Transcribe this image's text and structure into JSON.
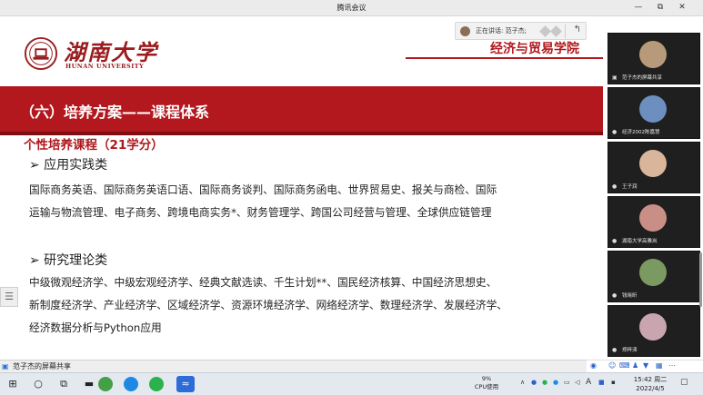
{
  "window": {
    "title": "腾讯会议",
    "controls": [
      "—",
      "⧉",
      "—",
      "☐",
      "✕"
    ]
  },
  "speaker": {
    "label": "正在讲话: 范子杰;"
  },
  "slide": {
    "logo_cn": "湖南大学",
    "logo_en": "HUNAN UNIVERSITY",
    "college": "经济与贸易学院",
    "heading": "（六）培养方案——课程体系",
    "subheading": "个性培养课程（21学分）",
    "sections": [
      {
        "title": "➢ 应用实践类",
        "lines": [
          "国际商务英语、国际商务英语口语、国际商务谈判、国际商务函电、世界贸易史、报关与商检、国际",
          "运输与物流管理、电子商务、跨境电商实务*、财务管理学、跨国公司经营与管理、全球供应链管理"
        ]
      },
      {
        "title": "➢ 研究理论类",
        "lines": [
          "中级微观经济学、中级宏观经济学、经典文献选读、千生计划**、国民经济核算、中国经济思想史、",
          "新制度经济学、产业经济学、区域经济学、资源环境经济学、网络经济学、数理经济学、发展经济学、",
          "经济数据分析与Python应用"
        ]
      }
    ]
  },
  "participants": [
    {
      "name": "范子杰的屏幕共享",
      "avatar_color": "#b79a7a"
    },
    {
      "name": "经济2002陈嘉慧",
      "avatar_color": "#6c8fbf"
    },
    {
      "name": "王子润",
      "avatar_color": "#d9b59c"
    },
    {
      "name": "湖南大学高雅岚",
      "avatar_color": "#c98f86"
    },
    {
      "name": "钱晓昕",
      "avatar_color": "#7a9a62"
    },
    {
      "name": "郑梓涛",
      "avatar_color": "#c9a5b0"
    }
  ],
  "share_bar": {
    "label": "范子杰的屏幕共享"
  },
  "taskbar": {
    "cpu_percent": "9%",
    "cpu_label": "CPU使用",
    "ime": "A",
    "time": "15:42 周二",
    "date": "2022/4/5"
  },
  "colors": {
    "brand_red": "#b2181d",
    "taskbar_bg": "#e4e9f0"
  }
}
